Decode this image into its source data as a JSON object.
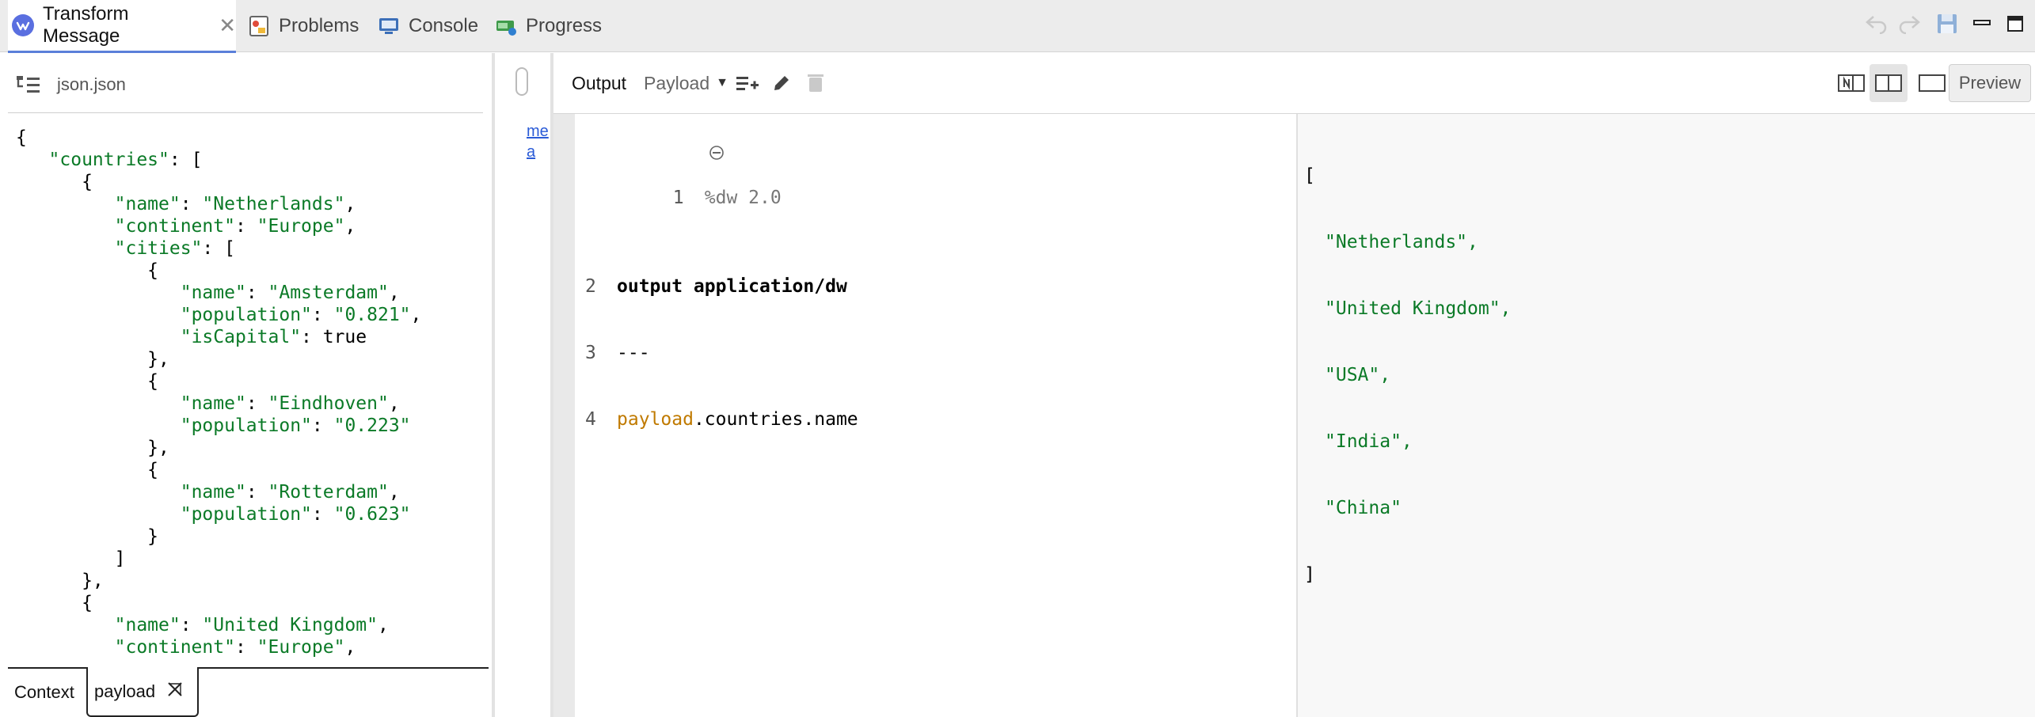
{
  "tabs": [
    {
      "label": "Transform Message",
      "icon": "dataweave-icon",
      "active": true
    },
    {
      "label": "Problems",
      "icon": "problems-icon"
    },
    {
      "label": "Console",
      "icon": "console-icon"
    },
    {
      "label": "Progress",
      "icon": "progress-icon"
    }
  ],
  "toolbar_right": [
    "undo-icon",
    "redo-icon",
    "save-icon",
    "minimize-icon",
    "maximize-icon"
  ],
  "input_panel": {
    "file_name": "json.json",
    "lines": [
      "{",
      "   \"countries\": [",
      "      {",
      "         \"name\": \"Netherlands\",",
      "         \"continent\": \"Europe\",",
      "         \"cities\": [",
      "            {",
      "               \"name\": \"Amsterdam\",",
      "               \"population\": \"0.821\",",
      "               \"isCapital\": true",
      "            },",
      "            {",
      "               \"name\": \"Eindhoven\",",
      "               \"population\": \"0.223\"",
      "            },",
      "            {",
      "               \"name\": \"Rotterdam\",",
      "               \"population\": \"0.623\"",
      "            }",
      "         ]",
      "      },",
      "      {",
      "         \"name\": \"United Kingdom\",",
      "         \"continent\": \"Europe\","
    ],
    "bottom_tabs": [
      "Context",
      "payload"
    ]
  },
  "mid_strip": {
    "link1": "me",
    "link2": "a"
  },
  "output_header": {
    "output_label": "Output",
    "target_select": "Payload",
    "preview_label": "Preview"
  },
  "script_editor": {
    "lines": [
      {
        "num": "1",
        "text": "%dw 2.0"
      },
      {
        "num": "2",
        "text": "output application/dw"
      },
      {
        "num": "3",
        "text": "---"
      },
      {
        "num": "4",
        "text_payload": "payload",
        "text_rest": ".countries.name"
      }
    ]
  },
  "preview_output": {
    "open": "[",
    "items": [
      "\"Netherlands\",",
      "\"United Kingdom\",",
      "\"USA\",",
      "\"India\",",
      "\"China\""
    ],
    "close": "]"
  }
}
